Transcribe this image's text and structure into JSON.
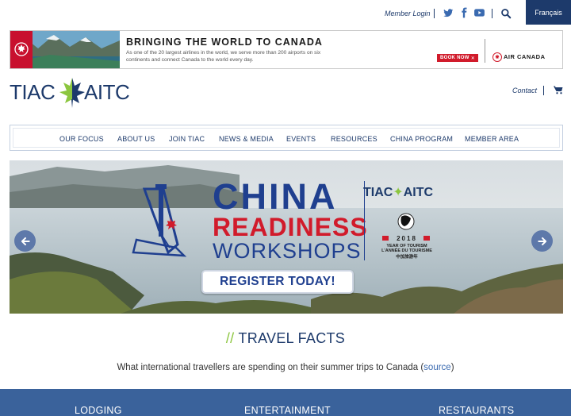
{
  "topbar": {
    "member_login": "Member Login",
    "social": [
      "twitter-icon",
      "facebook-icon",
      "youtube-icon"
    ],
    "language_button": "Français"
  },
  "ad": {
    "heading": "BRINGING THE WORLD TO CANADA",
    "body": "As one of the 20 largest airlines in the world, we serve more than 200 airports on six continents and connect Canada to the world every day.",
    "book_now": "BOOK NOW",
    "brand": "AIR CANADA"
  },
  "header": {
    "logo_left": "TIAC",
    "logo_right": "AITC",
    "contact": "Contact"
  },
  "nav": {
    "items": [
      "OUR FOCUS",
      "ABOUT US",
      "JOIN TIAC",
      "NEWS & MEDIA",
      "EVENTS",
      "RESOURCES",
      "CHINA PROGRAM",
      "MEMBER AREA"
    ]
  },
  "hero": {
    "line1": "CHINA",
    "line2": "READINESS",
    "line3": "WORKSHOPS",
    "logo_left": "TIAC",
    "logo_right": "AITC",
    "year": "2018",
    "year_line1": "YEAR OF TOURISM",
    "year_line2": "L'ANNÉE DU TOURISME",
    "year_line3": "中加旅游年",
    "register": "REGISTER TODAY!"
  },
  "facts": {
    "slash": "//",
    "title": "TRAVEL FACTS",
    "subtitle": "What international travellers are spending on their summer trips to Canada (",
    "source": "source",
    "close": ")"
  },
  "band": {
    "labels": [
      "LODGING",
      "ENTERTAINMENT",
      "RESTAURANTS"
    ]
  },
  "colors": {
    "navy": "#1d3a6b",
    "accent_green": "#8cc63f",
    "red": "#d11b2b",
    "band_blue": "#3a629b"
  }
}
